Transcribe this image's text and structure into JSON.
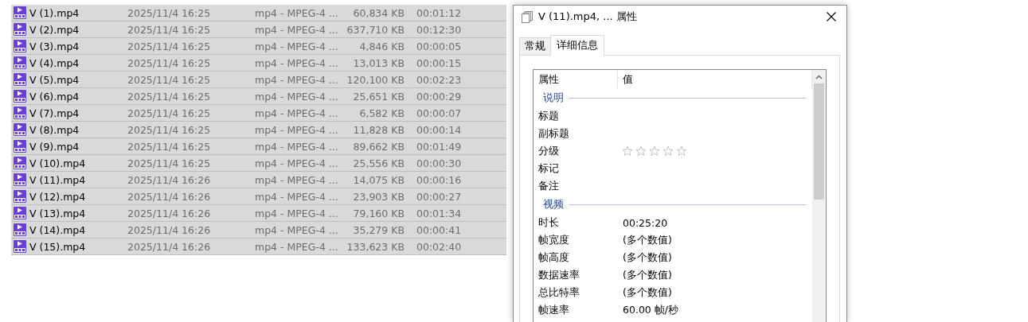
{
  "file_list": {
    "rows": [
      {
        "name": "V (1).mp4",
        "modified": "2025/11/4 16:25",
        "type": "mp4 - MPEG-4 ...",
        "size": "60,834 KB",
        "length": "00:01:12",
        "selected": true
      },
      {
        "name": "V (2).mp4",
        "modified": "2025/11/4 16:25",
        "type": "mp4 - MPEG-4 ...",
        "size": "637,710 KB",
        "length": "00:12:30",
        "selected": true
      },
      {
        "name": "V (3).mp4",
        "modified": "2025/11/4 16:25",
        "type": "mp4 - MPEG-4 ...",
        "size": "4,846 KB",
        "length": "00:00:05",
        "selected": true
      },
      {
        "name": "V (4).mp4",
        "modified": "2025/11/4 16:25",
        "type": "mp4 - MPEG-4 ...",
        "size": "13,013 KB",
        "length": "00:00:15",
        "selected": true
      },
      {
        "name": "V (5).mp4",
        "modified": "2025/11/4 16:25",
        "type": "mp4 - MPEG-4 ...",
        "size": "120,100 KB",
        "length": "00:02:23",
        "selected": true
      },
      {
        "name": "V (6).mp4",
        "modified": "2025/11/4 16:25",
        "type": "mp4 - MPEG-4 ...",
        "size": "25,651 KB",
        "length": "00:00:29",
        "selected": true
      },
      {
        "name": "V (7).mp4",
        "modified": "2025/11/4 16:25",
        "type": "mp4 - MPEG-4 ...",
        "size": "6,582 KB",
        "length": "00:00:07",
        "selected": true
      },
      {
        "name": "V (8).mp4",
        "modified": "2025/11/4 16:25",
        "type": "mp4 - MPEG-4 ...",
        "size": "11,828 KB",
        "length": "00:00:14",
        "selected": true
      },
      {
        "name": "V (9).mp4",
        "modified": "2025/11/4 16:25",
        "type": "mp4 - MPEG-4 ...",
        "size": "89,662 KB",
        "length": "00:01:49",
        "selected": true
      },
      {
        "name": "V (10).mp4",
        "modified": "2025/11/4 16:25",
        "type": "mp4 - MPEG-4 ...",
        "size": "25,556 KB",
        "length": "00:00:30",
        "selected": true
      },
      {
        "name": "V (11).mp4",
        "modified": "2025/11/4 16:26",
        "type": "mp4 - MPEG-4 ...",
        "size": "14,075 KB",
        "length": "00:00:16",
        "selected": true
      },
      {
        "name": "V (12).mp4",
        "modified": "2025/11/4 16:26",
        "type": "mp4 - MPEG-4 ...",
        "size": "23,903 KB",
        "length": "00:00:27",
        "selected": true
      },
      {
        "name": "V (13).mp4",
        "modified": "2025/11/4 16:26",
        "type": "mp4 - MPEG-4 ...",
        "size": "79,160 KB",
        "length": "00:01:34",
        "selected": true
      },
      {
        "name": "V (14).mp4",
        "modified": "2025/11/4 16:26",
        "type": "mp4 - MPEG-4 ...",
        "size": "35,279 KB",
        "length": "00:00:41",
        "selected": true
      },
      {
        "name": "V (15).mp4",
        "modified": "2025/11/4 16:26",
        "type": "mp4 - MPEG-4 ...",
        "size": "133,623 KB",
        "length": "00:02:40",
        "selected": true
      }
    ]
  },
  "dialog": {
    "title": "V (11).mp4, ... 属性",
    "tabs": [
      {
        "label": "常规",
        "selected": false
      },
      {
        "label": "详细信息",
        "selected": true
      }
    ],
    "details": {
      "columns": [
        "属性",
        "值"
      ],
      "items": [
        {
          "kind": "section",
          "label": "说明"
        },
        {
          "kind": "property",
          "name": "标题"
        },
        {
          "kind": "property",
          "name": "副标题"
        },
        {
          "kind": "rating",
          "name": "分级",
          "stars": 0
        },
        {
          "kind": "property",
          "name": "标记"
        },
        {
          "kind": "property",
          "name": "备注"
        },
        {
          "kind": "section",
          "label": "视频"
        },
        {
          "kind": "property",
          "name": "时长",
          "value": "00:25:20"
        },
        {
          "kind": "property",
          "name": "帧宽度",
          "value": "(多个数值)"
        },
        {
          "kind": "property",
          "name": "帧高度",
          "value": "(多个数值)"
        },
        {
          "kind": "property",
          "name": "数据速率",
          "value": "(多个数值)"
        },
        {
          "kind": "property",
          "name": "总比特率",
          "value": "(多个数值)"
        },
        {
          "kind": "property",
          "name": "帧速率",
          "value": "60.00 帧/秒"
        }
      ]
    }
  }
}
